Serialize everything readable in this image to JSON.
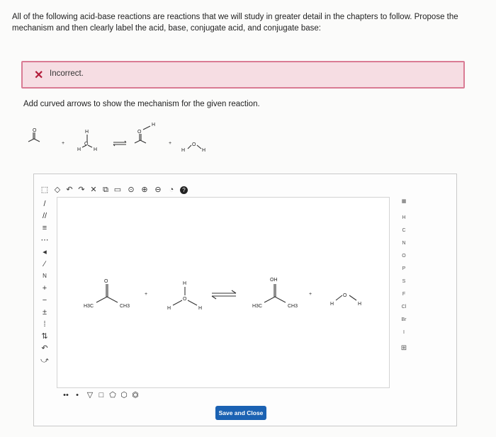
{
  "question": {
    "instructions": "All of the following acid-base reactions are reactions that we will study in greater detail in the chapters to follow. Propose the mechanism and then clearly label the acid, base, conjugate acid, and conjugate base:"
  },
  "result": {
    "icon": "close-icon",
    "status": "Incorrect."
  },
  "prompt": "Add curved arrows to show the mechanism for the given reaction.",
  "toolbar": {
    "top_tools": [
      "select-tool",
      "erase-tool",
      "undo-icon",
      "redo-icon",
      "clear-icon",
      "copy-icon",
      "paste-icon",
      "zoom-fit-icon",
      "zoom-in-icon",
      "zoom-out-icon",
      "zoom-reset-icon",
      "help-icon"
    ],
    "left_tools": [
      "single-bond-tool",
      "double-bond-tool",
      "triple-bond-tool",
      "dash-bond-tool",
      "wedge-bond-tool",
      "chain-tool",
      "charge-n-tool",
      "plus-charge-tool",
      "minus-charge-tool",
      "radical-tool",
      "lone-pair-tool",
      "electron-arrow-tool",
      "curved-arrow-single-tool",
      "curved-arrow-double-tool"
    ],
    "bottom_tools": [
      "lone-pair-icon",
      "radical-icon",
      "cyclopropane-icon",
      "cyclobutane-icon",
      "cyclopentane-icon",
      "cyclohexane-icon",
      "benzene-icon"
    ]
  },
  "elements": [
    "H",
    "C",
    "N",
    "O",
    "P",
    "S",
    "F",
    "Cl",
    "Br",
    "I"
  ],
  "canvas": {
    "labels": {
      "h3c_1": "H3C",
      "ch3_1": "CH3",
      "h_a": "H",
      "h_b": "H",
      "h_c": "H",
      "oh_plus": "OH",
      "plus_sign": "+",
      "h3c_2": "H3C",
      "ch3_2": "CH3",
      "h_d": "H",
      "h_e": "H"
    }
  },
  "reaction_preview": {
    "h1": "H",
    "h2": "H",
    "h3": "H",
    "h4": "H",
    "h5": "H",
    "h6": "H",
    "o_label": "O",
    "o_label2": "O",
    "o_label3": "O",
    "o_label4": "O",
    "plus1": "+",
    "plus2": "+"
  },
  "save_button": "Save and Close"
}
